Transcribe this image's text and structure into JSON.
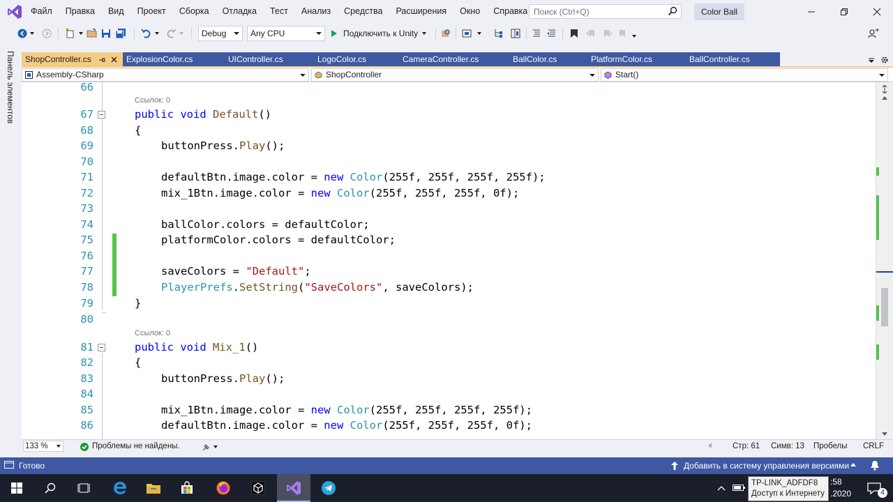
{
  "menu": [
    "Файл",
    "Правка",
    "Вид",
    "Проект",
    "Сборка",
    "Отладка",
    "Тест",
    "Анализ",
    "Средства",
    "Расширения",
    "Окно",
    "Справка"
  ],
  "search": {
    "placeholder": "Поиск (Ctrl+Q)"
  },
  "solution_name": "Color Ball",
  "toolbar": {
    "config": "Debug",
    "platform": "Any CPU",
    "run_label": "Подключить к Unity"
  },
  "side_panel_label": "Панель элементов",
  "tabs": [
    "ShopController.cs",
    "ExplosionColor.cs",
    "UIController.cs",
    "LogoColor.cs",
    "CameraController.cs",
    "BallColor.cs",
    "PlatformColor.cs",
    "BallController.cs"
  ],
  "nav": {
    "project": "Assembly-CSharp",
    "class": "ShopController",
    "member": "Start()"
  },
  "code": {
    "refs_label": "Ссылок: 0",
    "line_numbers": [
      "66",
      "67",
      "68",
      "69",
      "70",
      "71",
      "72",
      "73",
      "74",
      "75",
      "76",
      "77",
      "78",
      "79",
      "80",
      "81",
      "82",
      "83",
      "84",
      "85",
      "86"
    ],
    "l67": {
      "kw1": "public",
      "kw2": "void",
      "name": "Default",
      "rest": "()"
    },
    "l68": "{",
    "l69": {
      "obj": "buttonPress.",
      "fn": "Play",
      "rest": "();"
    },
    "l71": {
      "pre": "defaultBtn.image.color = ",
      "kw": "new",
      "ty": "Color",
      "args": "(255f, 255f, 255f, 255f);"
    },
    "l72": {
      "pre": "mix_1Btn.image.color = ",
      "kw": "new",
      "ty": "Color",
      "args": "(255f, 255f, 255f, 0f);"
    },
    "l74": "ballColor.colors = defaultColor;",
    "l75": "platformColor.colors = defaultColor;",
    "l77": {
      "pre": "saveColors = ",
      "str": "\"Default\"",
      "post": ";"
    },
    "l78": {
      "ty": "PlayerPrefs",
      "dot": ".",
      "fn": "SetString",
      "open": "(",
      "str": "\"SaveColors\"",
      "post": ", saveColors);"
    },
    "l79": "}",
    "l81": {
      "kw1": "public",
      "kw2": "void",
      "name": "Mix_1",
      "rest": "()"
    },
    "l82": "{",
    "l83": {
      "obj": "buttonPress.",
      "fn": "Play",
      "rest": "();"
    },
    "l85": {
      "pre": "mix_1Btn.image.color = ",
      "kw": "new",
      "ty": "Color",
      "args": "(255f, 255f, 255f, 255f);"
    },
    "l86": {
      "pre": "defaultBtn.image.color = ",
      "kw": "new",
      "ty": "Color",
      "args": "(255f, 255f, 255f, 0f);"
    }
  },
  "editor_status": {
    "zoom": "133 %",
    "problems": "Проблемы не найдены.",
    "line": "Стр: 61",
    "col": "Симв: 13",
    "ws": "Пробелы",
    "eol": "CRLF"
  },
  "statusbar": {
    "ready": "Готово",
    "vcs": "Добавить в систему управления версиями"
  },
  "taskbar": {
    "tooltip_line1": "TP-LINK_ADFDF8",
    "tooltip_line2": "Доступ к Интернету",
    "time": ":58",
    "date": ".2020",
    "notif_count": "4"
  },
  "colors": {
    "accent": "#3e58a2",
    "active_tab": "#f5cc84",
    "change_bar": "#57c34f"
  }
}
